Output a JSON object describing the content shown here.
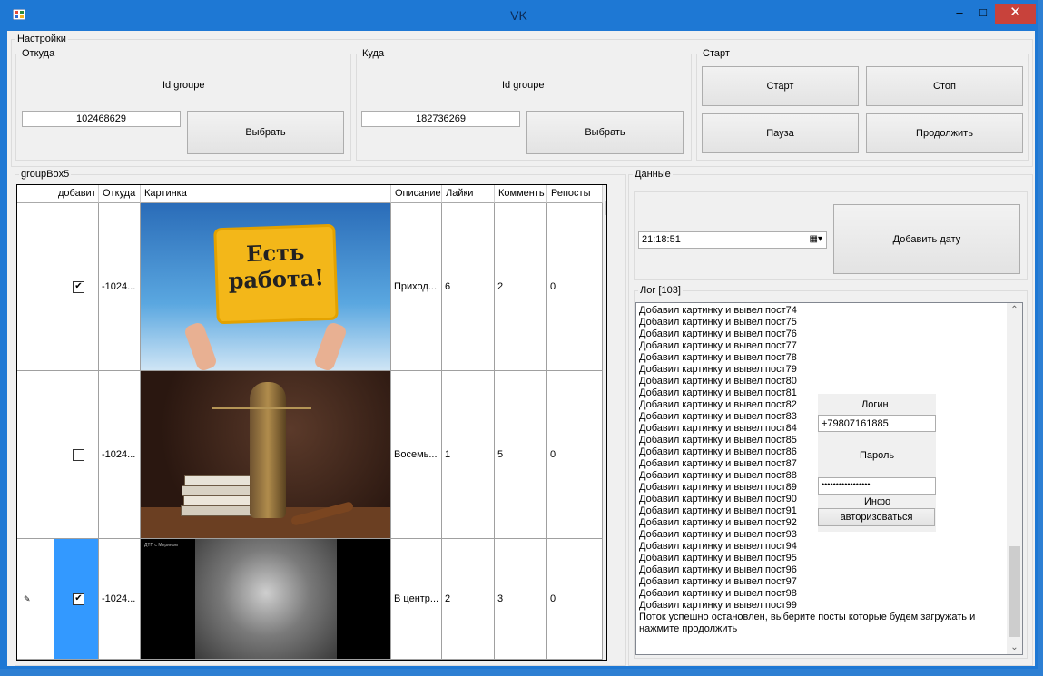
{
  "window": {
    "title": "VK"
  },
  "settings": {
    "title": "Настройки",
    "from": {
      "title": "Откуда",
      "label": "Id groupe",
      "value": "102468629",
      "button": "Выбрать"
    },
    "to": {
      "title": "Куда",
      "label": "Id groupe",
      "value": "182736269",
      "button": "Выбрать"
    },
    "start": {
      "title": "Старт",
      "start": "Старт",
      "stop": "Стоп",
      "pause": "Пауза",
      "resume": "Продолжить"
    }
  },
  "grid": {
    "title": "groupBox5",
    "headers": [
      "добавит",
      "Откуда",
      "Картинка",
      "Описание",
      "Лайки",
      "Комменть",
      "Репосты"
    ],
    "rows": [
      {
        "checked": true,
        "from": "-1024...",
        "desc": "Приход...",
        "likes": "6",
        "comments": "2",
        "reposts": "0"
      },
      {
        "checked": false,
        "from": "-1024...",
        "desc": "Восемь...",
        "likes": "1",
        "comments": "5",
        "reposts": "0"
      },
      {
        "checked": true,
        "from": "-1024...",
        "desc": "В центр...",
        "likes": "2",
        "comments": "3",
        "reposts": "0"
      }
    ],
    "image1_text": [
      "Есть",
      "работа!"
    ],
    "image3_caption": "ДТП с Мерином"
  },
  "data": {
    "title": "Данные",
    "time": "21:18:51",
    "add_date": "Добавить дату"
  },
  "log": {
    "title": "Лог [103]",
    "lines": [
      "Добавил картинку и вывел пост74",
      "Добавил картинку и вывел пост75",
      "Добавил картинку и вывел пост76",
      "Добавил картинку и вывел пост77",
      "Добавил картинку и вывел пост78",
      "Добавил картинку и вывел пост79",
      "Добавил картинку и вывел пост80",
      "Добавил картинку и вывел пост81",
      "Добавил картинку и вывел пост82",
      "Добавил картинку и вывел пост83",
      "Добавил картинку и вывел пост84",
      "Добавил картинку и вывел пост85",
      "Добавил картинку и вывел пост86",
      "Добавил картинку и вывел пост87",
      "Добавил картинку и вывел пост88",
      "Добавил картинку и вывел пост89",
      "Добавил картинку и вывел пост90",
      "Добавил картинку и вывел пост91",
      "Добавил картинку и вывел пост92",
      "Добавил картинку и вывел пост93",
      "Добавил картинку и вывел пост94",
      "Добавил картинку и вывел пост95",
      "Добавил картинку и вывел пост96",
      "Добавил картинку и вывел пост97",
      "Добавил картинку и вывел пост98",
      "Добавил картинку и вывел пост99",
      "Поток успешно остановлен, выберите посты которые будем загружать и",
      "нажмите продолжить"
    ]
  },
  "auth": {
    "login_label": "Логин",
    "login_value": "+79807161885",
    "password_label": "Пароль",
    "password_value": "•••••••••••••••••",
    "info": "Инфо",
    "button": "авторизоваться"
  }
}
